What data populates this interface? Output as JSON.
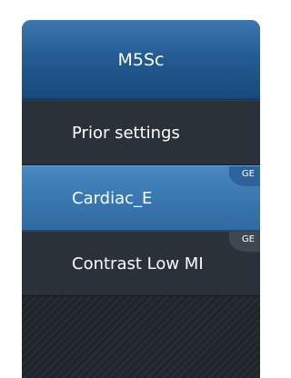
{
  "panel": {
    "title": "M5Sc",
    "items": [
      {
        "label": "Prior settings",
        "badge": "",
        "selected": false
      },
      {
        "label": "Cardiac_E",
        "badge": "GE",
        "selected": true
      },
      {
        "label": "Contrast Low MI",
        "badge": "GE",
        "selected": false
      }
    ]
  },
  "colors": {
    "header_blue": "#245d93",
    "selected_blue": "#3876af",
    "item_dark": "#2a3138",
    "background_dark": "#1f2429",
    "text": "#ffffff"
  }
}
